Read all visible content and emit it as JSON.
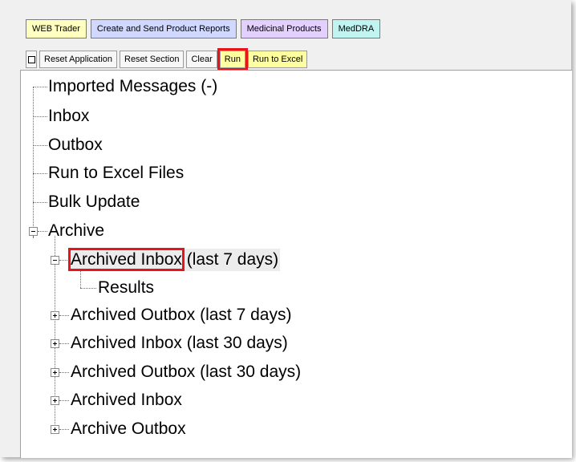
{
  "tabs": [
    "WEB Trader",
    "Create and Send Product Reports",
    "Medicinal Products",
    "MedDRA"
  ],
  "toolbar": {
    "reset_application": "Reset Application",
    "reset_section": "Reset Section",
    "clear": "Clear",
    "run": "Run",
    "run_to_excel": "Run to Excel"
  },
  "tree": {
    "imported_messages": "Imported Messages (-)",
    "inbox": "Inbox",
    "outbox": "Outbox",
    "run_to_excel_files": "Run to Excel Files",
    "bulk_update": "Bulk Update",
    "archive": "Archive",
    "archived_inbox_7_name": "Archived Inbox",
    "archived_inbox_7_suffix": " (last 7 days)",
    "results": "Results",
    "archived_outbox_7": "Archived Outbox (last 7 days)",
    "archived_inbox_30": "Archived Inbox (last 30 days)",
    "archived_outbox_30": "Archived Outbox (last 30 days)",
    "archived_inbox": "Archived Inbox",
    "archive_outbox": "Archive Outbox"
  },
  "colors": {
    "highlight": "#e8141c",
    "tab_web_trader": "#ffffc0",
    "tab_reports": "#d0d8ff",
    "tab_medicinal": "#e4d0ff",
    "tab_meddra": "#bff4f0",
    "run_button": "#ffffa0"
  }
}
